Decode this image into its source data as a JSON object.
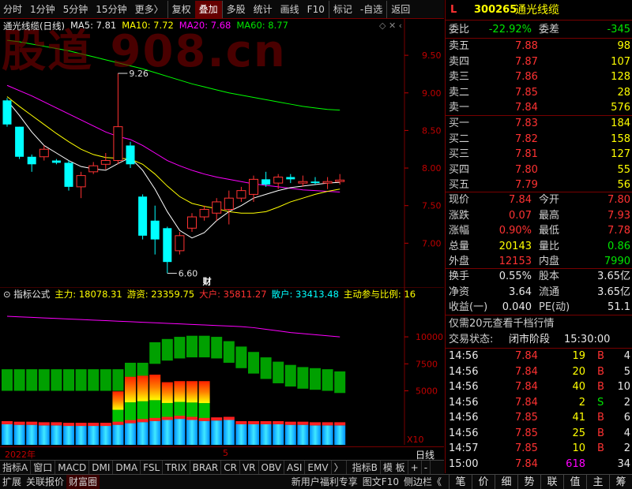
{
  "toolbar": {
    "items": [
      "分时",
      "1分钟",
      "5分钟",
      "15分钟",
      "更多〉",
      "复权",
      "叠加",
      "多股",
      "统计",
      "画线",
      "F10",
      "标记",
      "-自选",
      "返回"
    ],
    "active": "叠加"
  },
  "watermark": "股道 908.cn",
  "chart_header": {
    "title": "通光线缆(日线)",
    "ma5": "MA5: 7.81",
    "ma10": "MA10: 7.72",
    "ma20": "MA20: 7.68",
    "ma60": "MA60: 8.77"
  },
  "colors": {
    "ma5": "#ffffff",
    "ma10": "#ffff00",
    "ma20": "#ff00ff",
    "ma60": "#00ff00",
    "up": "#ff3232",
    "down": "#00ffff",
    "axis": "#c00000"
  },
  "chart_data": [
    {
      "type": "candlestick",
      "title": "通光线缆(日线)",
      "y_ticks": [
        "9.50",
        "9.00",
        "8.50",
        "8.00",
        "7.50",
        "7.00"
      ],
      "ylim": [
        6.5,
        9.9
      ],
      "annotations": [
        "9.26",
        "6.60",
        "财"
      ],
      "ohlc": [
        [
          8.9,
          8.93,
          8.55,
          8.58
        ],
        [
          8.55,
          8.55,
          8.12,
          8.15
        ],
        [
          8.15,
          8.18,
          7.95,
          8.05
        ],
        [
          8.15,
          8.3,
          8.1,
          8.25
        ],
        [
          8.1,
          8.12,
          8.05,
          8.07
        ],
        [
          8.07,
          8.1,
          7.7,
          7.75
        ],
        [
          7.75,
          7.95,
          7.6,
          7.9
        ],
        [
          7.95,
          8.08,
          7.92,
          8.03
        ],
        [
          8.05,
          8.2,
          7.98,
          8.1
        ],
        [
          8.1,
          9.26,
          8.05,
          8.55
        ],
        [
          8.3,
          8.35,
          8.0,
          8.05
        ],
        [
          7.62,
          7.65,
          7.05,
          7.1
        ],
        [
          7.3,
          7.5,
          6.85,
          7.05
        ],
        [
          7.2,
          7.22,
          6.6,
          6.75
        ],
        [
          6.9,
          7.15,
          6.85,
          7.1
        ],
        [
          7.2,
          7.4,
          7.15,
          7.35
        ],
        [
          7.35,
          7.5,
          7.3,
          7.45
        ],
        [
          7.4,
          7.6,
          7.3,
          7.55
        ],
        [
          7.45,
          7.7,
          7.25,
          7.6
        ],
        [
          7.6,
          7.75,
          7.55,
          7.7
        ],
        [
          7.65,
          7.9,
          7.55,
          7.85
        ],
        [
          7.85,
          7.95,
          7.75,
          7.78
        ],
        [
          7.8,
          7.92,
          7.72,
          7.88
        ],
        [
          7.88,
          7.92,
          7.8,
          7.85
        ],
        [
          7.8,
          7.9,
          7.75,
          7.82
        ],
        [
          7.82,
          7.88,
          7.78,
          7.8
        ],
        [
          7.8,
          7.88,
          7.72,
          7.82
        ],
        [
          7.82,
          7.92,
          7.78,
          7.84
        ]
      ],
      "ma5": [
        8.9,
        8.7,
        8.48,
        8.3,
        8.2,
        8.1,
        8.02,
        7.99,
        7.97,
        8.06,
        8.14,
        7.97,
        7.72,
        7.42,
        7.17,
        7.07,
        7.14,
        7.3,
        7.42,
        7.5,
        7.6,
        7.65,
        7.7,
        7.74,
        7.76,
        7.78,
        7.8,
        7.81
      ],
      "ma10": [
        8.95,
        8.82,
        8.7,
        8.58,
        8.46,
        8.35,
        8.25,
        8.18,
        8.14,
        8.13,
        8.12,
        8.05,
        7.92,
        7.76,
        7.62,
        7.53,
        7.49,
        7.46,
        7.42,
        7.4,
        7.4,
        7.42,
        7.48,
        7.55,
        7.6,
        7.65,
        7.69,
        7.72
      ],
      "ma20": [
        9.1,
        9.03,
        8.96,
        8.88,
        8.8,
        8.72,
        8.64,
        8.56,
        8.48,
        8.42,
        8.38,
        8.3,
        8.2,
        8.1,
        8.03,
        7.97,
        7.92,
        7.88,
        7.85,
        7.82,
        7.79,
        7.77,
        7.75,
        7.73,
        7.71,
        7.7,
        7.69,
        7.68
      ],
      "ma60": [
        9.7,
        9.68,
        9.65,
        9.62,
        9.59,
        9.56,
        9.52,
        9.48,
        9.44,
        9.4,
        9.36,
        9.32,
        9.27,
        9.22,
        9.17,
        9.12,
        9.08,
        9.04,
        9.0,
        8.97,
        8.94,
        8.91,
        8.88,
        8.85,
        8.82,
        8.8,
        8.78,
        8.77
      ]
    },
    {
      "type": "bar",
      "title": "指标公式",
      "y_ticks": [
        "10000",
        "7500",
        "5000"
      ],
      "ylim": [
        0,
        13000
      ],
      "series_labels": {
        "main": "主力: 18078.31",
        "hot": "游资: 23359.75",
        "big": "大户: 35811.27",
        "retail": "散户: 33413.48",
        "ratio": "主动参与比例: 16"
      },
      "green_bars": [
        7000,
        7000,
        7000,
        7000,
        7000,
        7000,
        7000,
        7000,
        7000,
        7000,
        7600,
        7600,
        9500,
        9800,
        10000,
        10100,
        10100,
        10000,
        9600,
        9100,
        8600,
        8100,
        7700,
        7400,
        7200,
        7100,
        7000,
        6800
      ],
      "blue_bars": [
        1900,
        1850,
        1850,
        1800,
        1800,
        1750,
        1750,
        1750,
        1750,
        1850,
        2000,
        2100,
        2200,
        2300,
        2400,
        2300,
        2200,
        2250,
        2300,
        1900,
        1900,
        1900,
        1900,
        1850,
        1850,
        1800,
        1800,
        1800
      ],
      "stack_bars": [
        0,
        0,
        0,
        0,
        0,
        0,
        0,
        0,
        0,
        3100,
        4300,
        4300,
        4300,
        3500,
        3500,
        3600,
        3700,
        0,
        0,
        0,
        0,
        0,
        0,
        0,
        0,
        0,
        0,
        0
      ],
      "magenta_line": [
        11900,
        11850,
        11800,
        11750,
        11700,
        11650,
        11600,
        11550,
        11500,
        11450,
        11400,
        11350,
        11300,
        11250,
        11200,
        11150,
        11100,
        11050,
        11000,
        10950,
        10850,
        10700,
        10550,
        10400,
        10300,
        10200,
        10100,
        10000
      ]
    }
  ],
  "sub_xlabel": "X10",
  "axis": {
    "year": "2022年",
    "month": "5",
    "period": "日线"
  },
  "indicator_tabs": [
    "指标A",
    "窗口",
    "MACD",
    "DMI",
    "DMA",
    "FSL",
    "TRIX",
    "BRAR",
    "CR",
    "VR",
    "OBV",
    "ASI",
    "EMV",
    "〉",
    "指标B",
    "模 板",
    "+",
    "-"
  ],
  "footer_left": [
    "扩展",
    "关联报价",
    "财富圈"
  ],
  "footer_mid": [
    "新用户福利专享",
    "图文F10",
    "侧边栏《"
  ],
  "right_tabs": [
    "笔",
    "价",
    "细",
    "势",
    "联",
    "值",
    "主",
    "筹"
  ],
  "quote": {
    "mark": "L",
    "code": "300265",
    "name": "通光线缆",
    "weibi_label": "委比",
    "weibi": "-22.92%",
    "weicha_label": "委差",
    "weicha": "-345",
    "asks": [
      {
        "label": "卖五",
        "price": "7.88",
        "vol": "98"
      },
      {
        "label": "卖四",
        "price": "7.87",
        "vol": "107"
      },
      {
        "label": "卖三",
        "price": "7.86",
        "vol": "128"
      },
      {
        "label": "卖二",
        "price": "7.85",
        "vol": "28"
      },
      {
        "label": "卖一",
        "price": "7.84",
        "vol": "576"
      }
    ],
    "bids": [
      {
        "label": "买一",
        "price": "7.83",
        "vol": "184"
      },
      {
        "label": "买二",
        "price": "7.82",
        "vol": "158"
      },
      {
        "label": "买三",
        "price": "7.81",
        "vol": "127"
      },
      {
        "label": "买四",
        "price": "7.80",
        "vol": "55"
      },
      {
        "label": "买五",
        "price": "7.79",
        "vol": "56"
      }
    ],
    "stats": [
      {
        "l1": "现价",
        "v1": "7.84",
        "c1": "red",
        "l2": "今开",
        "v2": "7.80",
        "c2": "red"
      },
      {
        "l1": "涨跌",
        "v1": "0.07",
        "c1": "red",
        "l2": "最高",
        "v2": "7.93",
        "c2": "red"
      },
      {
        "l1": "涨幅",
        "v1": "0.90%",
        "c1": "red",
        "l2": "最低",
        "v2": "7.78",
        "c2": "red"
      },
      {
        "l1": "总量",
        "v1": "20143",
        "c1": "yellow",
        "l2": "量比",
        "v2": "0.86",
        "c2": "green"
      },
      {
        "l1": "外盘",
        "v1": "12153",
        "c1": "red",
        "l2": "内盘",
        "v2": "7990",
        "c2": "green"
      }
    ],
    "stats2": [
      {
        "l1": "换手",
        "v1": "0.55%",
        "l2": "股本",
        "v2": "3.65亿"
      },
      {
        "l1": "净资",
        "v1": "3.64",
        "l2": "流通",
        "v2": "3.65亿"
      },
      {
        "l1": "收益(一)",
        "v1": "0.040",
        "l2": "PE(动)",
        "v2": "51.1"
      }
    ],
    "promo": "仅需20元查看千档行情",
    "status_label": "交易状态:",
    "status_value": "闭市阶段",
    "status_time": "15:30:00",
    "ticks": [
      {
        "time": "14:56",
        "price": "7.84",
        "vol": "19",
        "side": "B",
        "n": "4"
      },
      {
        "time": "14:56",
        "price": "7.84",
        "vol": "20",
        "side": "B",
        "n": "5"
      },
      {
        "time": "14:56",
        "price": "7.84",
        "vol": "40",
        "side": "B",
        "n": "10"
      },
      {
        "time": "14:56",
        "price": "7.84",
        "vol": "2",
        "side": "S",
        "n": "2"
      },
      {
        "time": "14:56",
        "price": "7.85",
        "vol": "41",
        "side": "B",
        "n": "6"
      },
      {
        "time": "14:56",
        "price": "7.85",
        "vol": "25",
        "side": "B",
        "n": "4"
      },
      {
        "time": "14:57",
        "price": "7.85",
        "vol": "10",
        "side": "B",
        "n": "2"
      },
      {
        "time": "15:00",
        "price": "7.84",
        "vol": "618",
        "side": "",
        "n": "34"
      }
    ]
  }
}
